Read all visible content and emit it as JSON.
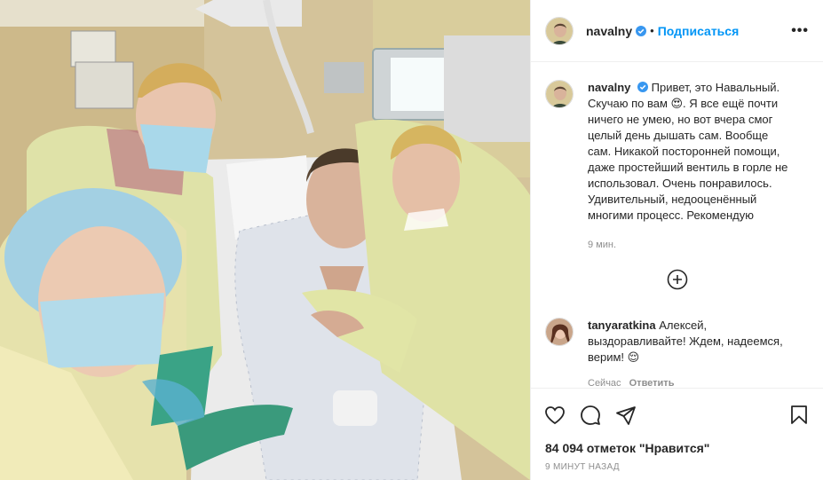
{
  "post": {
    "username": "navalny",
    "follow_label": "Подписаться",
    "more_label": "•••",
    "caption_author": "navalny",
    "caption": "Привет, это Навальный. Скучаю по вам 😍. Я все ещё почти ничего не умею, но вот вчера смог целый день дышать сам. Вообще сам. Никакой посторонней помощи, даже простейший вентиль в горле не использовал. Очень понравилось. Удивительный, недооценённый многими процесс. Рекомендую",
    "caption_time": "9 мин.",
    "comment_author": "tanyaratkina",
    "comment_text": "Алексей, выздоравливайте! Ждем, надеемся, верим! 😌",
    "comment_time": "Сейчас",
    "comment_reply": "Ответить",
    "likes": "84 094 отметок \"Нравится\"",
    "posted_ago": "9 МИНУТ НАЗАД"
  },
  "colors": {
    "accent": "#0095f6",
    "verified": "#3897f0",
    "secondary": "#8e8e8e"
  },
  "icons": [
    "verified-icon",
    "more-icon",
    "plus-circle-icon",
    "heart-icon",
    "comment-icon",
    "share-icon",
    "bookmark-icon"
  ]
}
